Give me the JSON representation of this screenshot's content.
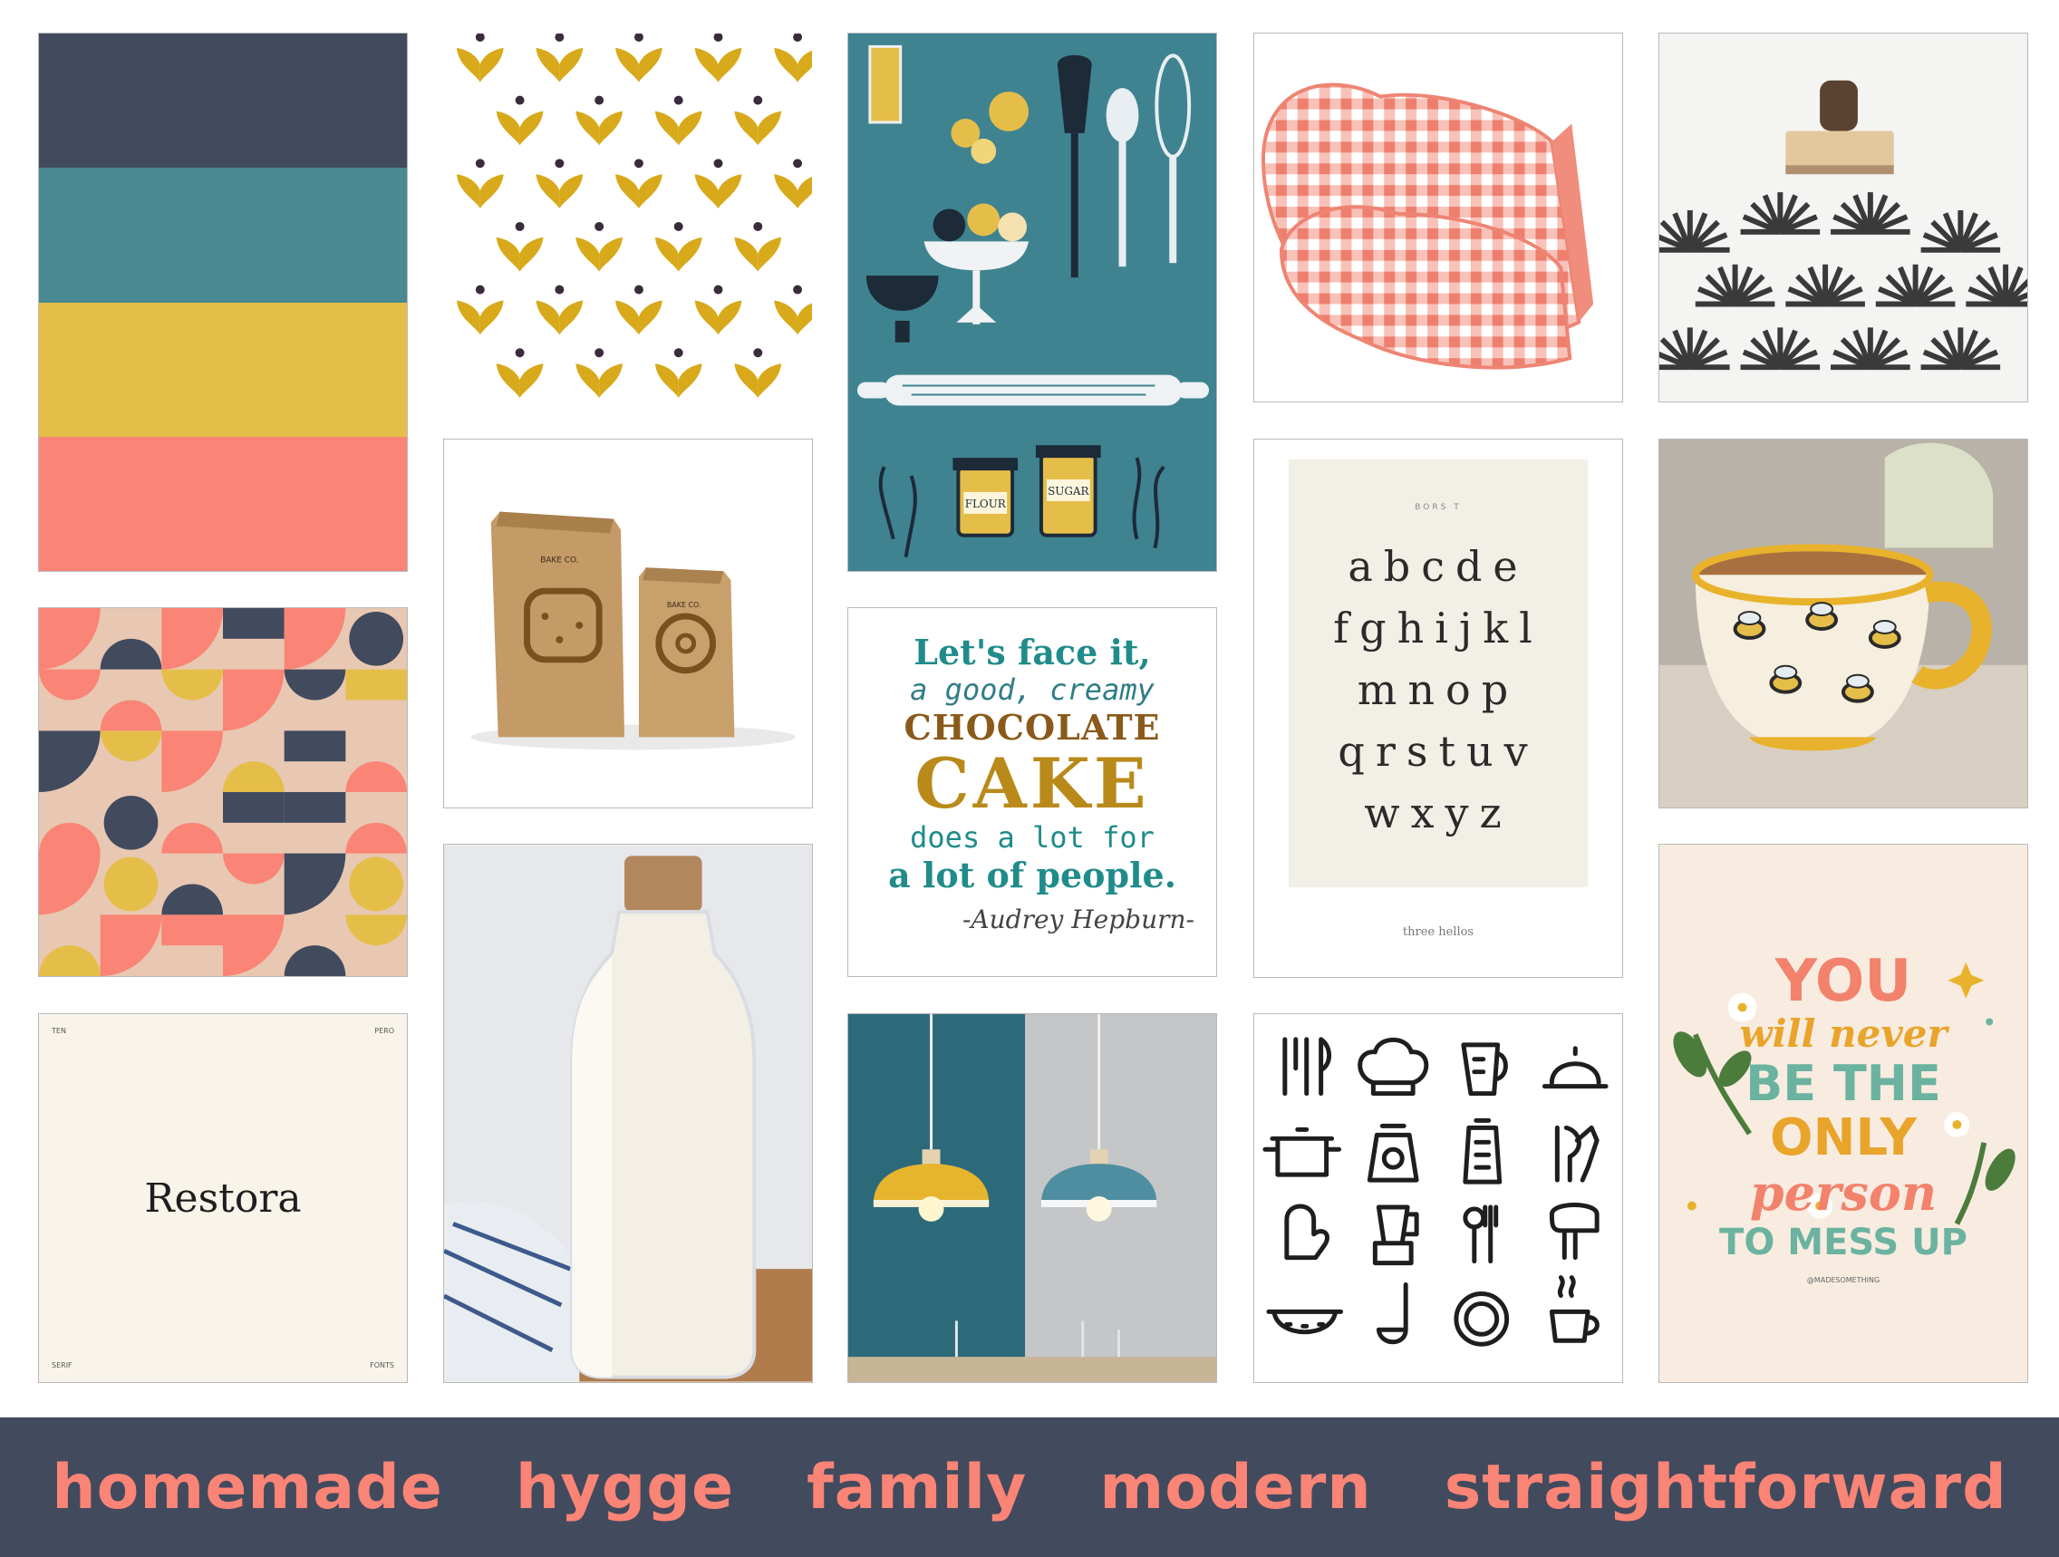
{
  "colors": {
    "navy": "#424a5e",
    "teal": "#4a8992",
    "mustard": "#e5be4a",
    "coral": "#fa8475",
    "gold": "#d8a91a",
    "cream": "#f8f4ea"
  },
  "palette": [
    "#424a5e",
    "#4a8992",
    "#e5be4a",
    "#fa8475"
  ],
  "quote": {
    "line1": "Let's face it,",
    "line2": "a good, creamy",
    "line3": "CHOCOLATE",
    "line4": "CAKE",
    "line5": "does a lot for",
    "line6": "a lot of people.",
    "author": "-Audrey Hepburn-"
  },
  "alphabet": {
    "header": "BORS T",
    "rows": [
      "abcde",
      "fghijkl",
      "mnop",
      "qrstuv",
      "wxyz"
    ],
    "footer": "three hellos"
  },
  "font_card": {
    "name": "Restora",
    "corner_tl": "TEN",
    "corner_tr": "PERO",
    "corner_bl": "SERIF",
    "corner_br": "FONTS"
  },
  "bags": {
    "label_left": "BAKE CO.",
    "label_right": "BAKE CO."
  },
  "kitchen_poster": {
    "jar1": "FLOUR",
    "jar2": "SUGAR"
  },
  "lettering": {
    "line1": "YOU",
    "line2": "will never",
    "line3": "BE THE",
    "line4": "ONLY",
    "line5": "person",
    "line6": "TO MESS UP",
    "handle": "@MADESOMETHING"
  },
  "icons": [
    "cutlery-icon",
    "chef-hat-icon",
    "measuring-jug-icon",
    "cloche-icon",
    "pot-icon",
    "scale-icon",
    "grater-icon",
    "knife-icon",
    "oven-mitt-icon",
    "blender-icon",
    "utensils-icon",
    "mixer-icon",
    "colander-icon",
    "ladle-icon",
    "plate-icon",
    "coffee-cup-icon"
  ],
  "keywords": [
    "homemade",
    "hygge",
    "family",
    "modern",
    "straightforward"
  ]
}
